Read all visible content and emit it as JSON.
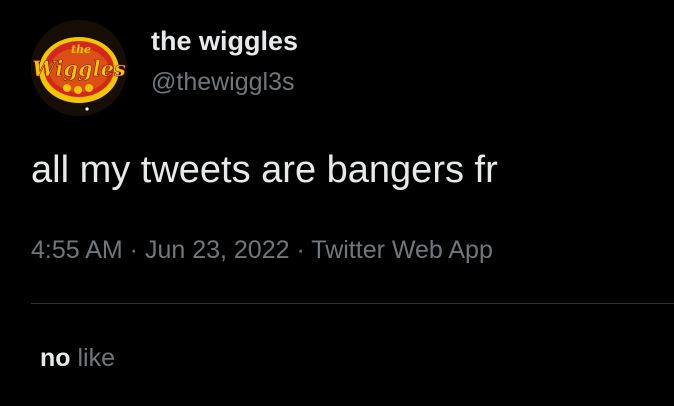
{
  "tweet": {
    "author": {
      "display_name": "the wiggles",
      "handle": "@thewiggl3s",
      "avatar_logo_text": "Wiggles",
      "avatar_logo_small_text": "the"
    },
    "text": "all my tweets are bangers fr",
    "meta": {
      "time": "4:55 AM",
      "separator": " · ",
      "date": "Jun 23, 2022",
      "source": "Twitter Web App"
    },
    "stats": {
      "likes_count": "no",
      "likes_label": "like"
    }
  },
  "colors": {
    "background": "#000000",
    "primary_text": "#e7e9ea",
    "secondary_text": "#71767b",
    "divider": "#2f3336",
    "logo_red": "#d4271c",
    "logo_yellow": "#f3c600"
  }
}
